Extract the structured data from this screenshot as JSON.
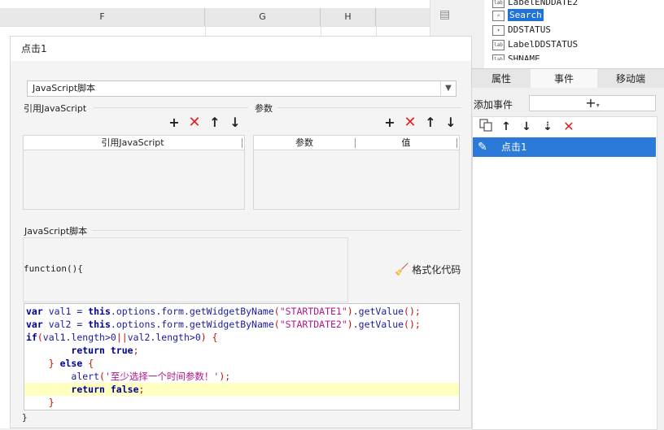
{
  "sheet": {
    "columns": [
      "F",
      "G",
      "H"
    ]
  },
  "tree": {
    "items": [
      {
        "label": "LabelENDDATE2",
        "icon": "label-widget-icon"
      },
      {
        "label": "Search",
        "icon": "search-widget-icon",
        "selected": true
      },
      {
        "label": "DDSTATUS",
        "icon": "combo-widget-icon"
      },
      {
        "label": "LabelDDSTATUS",
        "icon": "label-widget-icon"
      },
      {
        "label": "SHNAME",
        "icon": "label-widget-icon"
      }
    ]
  },
  "tabs": [
    "属性",
    "事件",
    "移动端"
  ],
  "events": {
    "add_label": "添加事件",
    "add_button": "+",
    "tools": [
      "copy-icon",
      "move-up-icon",
      "move-down-icon",
      "move-bottom-icon",
      "delete-icon"
    ],
    "items": [
      {
        "label": "点击1",
        "selected": true
      }
    ]
  },
  "dialog": {
    "title": "点击1",
    "type_value": "JavaScript脚本",
    "ref_section": "引用JavaScript",
    "param_section": "参数",
    "ref_table": {
      "headers": [
        "引用JavaScript"
      ]
    },
    "param_table": {
      "headers": [
        "参数",
        "值"
      ]
    },
    "script_section": "JavaScript脚本",
    "func_head": "function(){",
    "format_label": "格式化代码",
    "func_close": "}",
    "code": [
      "var val1 = this.options.form.getWidgetByName(\"STARTDATE1\").getValue();",
      "var val2 = this.options.form.getWidgetByName(\"STARTDATE2\").getValue();",
      "if(val1.length>0||val2.length>0) {",
      "        return true;",
      "    } else {",
      "        alert('至少选择一个时间参数！');",
      "        return false;",
      "    }"
    ]
  },
  "colors": {
    "accent": "#2b7ad9",
    "delete": "#e02020",
    "current_line": "#ffffc0"
  }
}
